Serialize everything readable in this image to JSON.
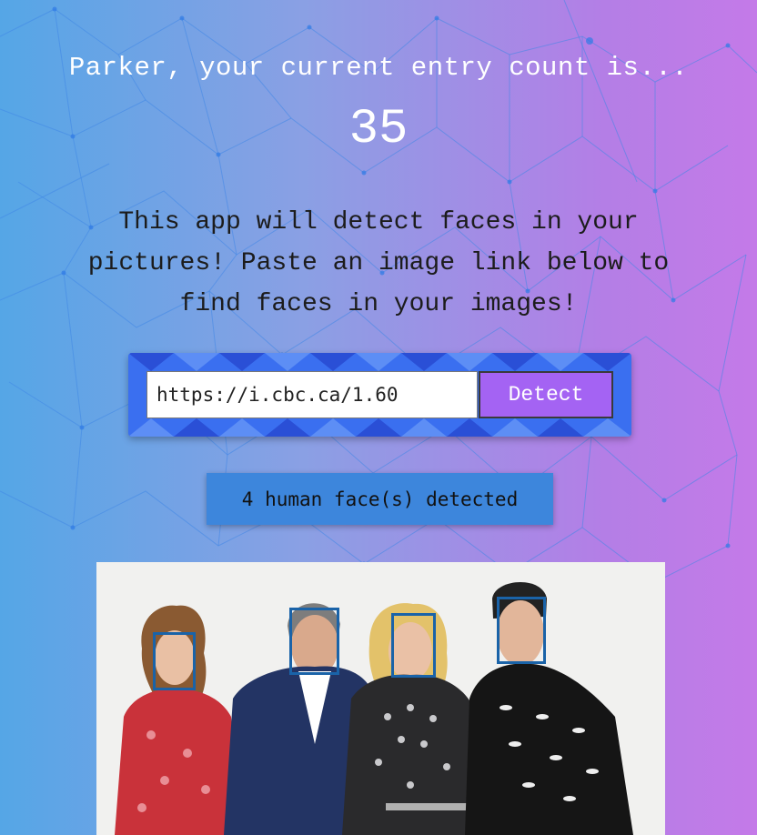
{
  "header": {
    "greeting": "Parker, your current entry count is...",
    "entry_count": "35"
  },
  "intro": {
    "text": "This app will detect faces in your pictures! Paste an image link below to find faces in your images!"
  },
  "form": {
    "url_value": "https://i.cbc.ca/1.60",
    "detect_label": "Detect"
  },
  "result": {
    "message": "4 human face(s) detected"
  },
  "photo": {
    "faces_detected": 4
  },
  "colors": {
    "background_left": "#55a6e6",
    "background_right": "#c47ae8",
    "button": "#a463f3",
    "result_badge": "#3d86dc",
    "face_box": "#1a63a8"
  }
}
